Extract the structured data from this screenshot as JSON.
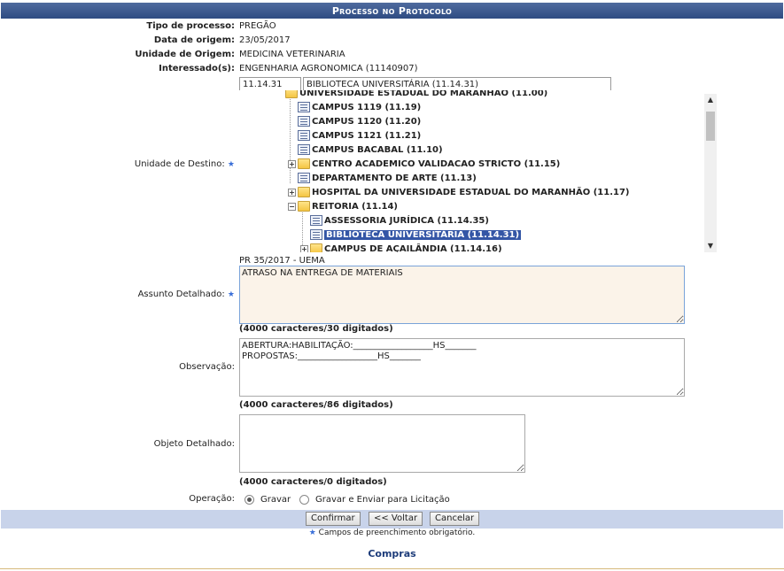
{
  "header": {
    "title": "Processo no Protocolo"
  },
  "info": {
    "tipo_label": "Tipo de processo:",
    "tipo_value": "PREGÃO",
    "data_label": "Data de origem:",
    "data_value": "23/05/2017",
    "unidade_label": "Unidade de Origem:",
    "unidade_value": "MEDICINA VETERINARIA",
    "interessados_label": "Interessado(s):",
    "interessados_value": "ENGENHARIA AGRONOMICA (11140907)"
  },
  "destino": {
    "label": "Unidade de Destino:",
    "code_value": "11.14.31",
    "name_value": "BIBLIOTECA UNIVERSITÁRIA (11.14.31)",
    "tree": [
      {
        "label": "UNIVERSIDADE ESTADUAL DO MARANHÃO (11.00)",
        "type": "folder"
      },
      {
        "label": "CAMPUS 1119 (11.19)",
        "type": "leaf"
      },
      {
        "label": "CAMPUS 1120 (11.20)",
        "type": "leaf"
      },
      {
        "label": "CAMPUS 1121 (11.21)",
        "type": "leaf"
      },
      {
        "label": "CAMPUS BACABAL (11.10)",
        "type": "leaf"
      },
      {
        "label": "CENTRO ACADEMICO VALIDACAO STRICTO (11.15)",
        "type": "folder",
        "expander": "+"
      },
      {
        "label": "DEPARTAMENTO DE ARTE (11.13)",
        "type": "leaf"
      },
      {
        "label": "HOSPITAL DA UNIVERSIDADE ESTADUAL DO MARANHÃO (11.17)",
        "type": "folder",
        "expander": "+"
      },
      {
        "label": "REITORIA (11.14)",
        "type": "folder",
        "expander": "−"
      },
      {
        "label": "ASSESSORIA JURÍDICA (11.14.35)",
        "type": "leaf"
      },
      {
        "label": "BIBLIOTECA UNIVERSITÁRIA (11.14.31)",
        "type": "leaf",
        "selected": true
      },
      {
        "label": "CAMPUS DE AÇAILÂNDIA (11.14.16)",
        "type": "folder",
        "expander": "+"
      }
    ]
  },
  "assunto": {
    "label": "Assunto Detalhado:",
    "codigo": "PR 35/2017 - UEMA",
    "value": "ATRASO NA ENTREGA DE MATERIAIS",
    "counter": "(4000 caracteres/30 digitados)"
  },
  "observacao": {
    "label": "Observação:",
    "value": "ABERTURA:HABILITAÇÃO:__________________HS_______\nPROPOSTAS:__________________HS_______",
    "counter": "(4000 caracteres/86 digitados)"
  },
  "objeto": {
    "label": "Objeto Detalhado:",
    "value": "",
    "counter": "(4000 caracteres/0 digitados)"
  },
  "operacao": {
    "label": "Operação:",
    "option1": "Gravar",
    "option2": "Gravar e Enviar para Licitação",
    "selected": "Gravar"
  },
  "buttons": {
    "confirmar": "Confirmar",
    "voltar": "<< Voltar",
    "cancelar": "Cancelar"
  },
  "footer": {
    "required_note": "Campos de preenchimento obrigatório.",
    "required_star": "★",
    "link": "Compras"
  },
  "colors": {
    "header": "#2e4b82",
    "selection": "#3456a6",
    "footer_bar": "#c8d3ea",
    "link": "#1d3c7a"
  }
}
